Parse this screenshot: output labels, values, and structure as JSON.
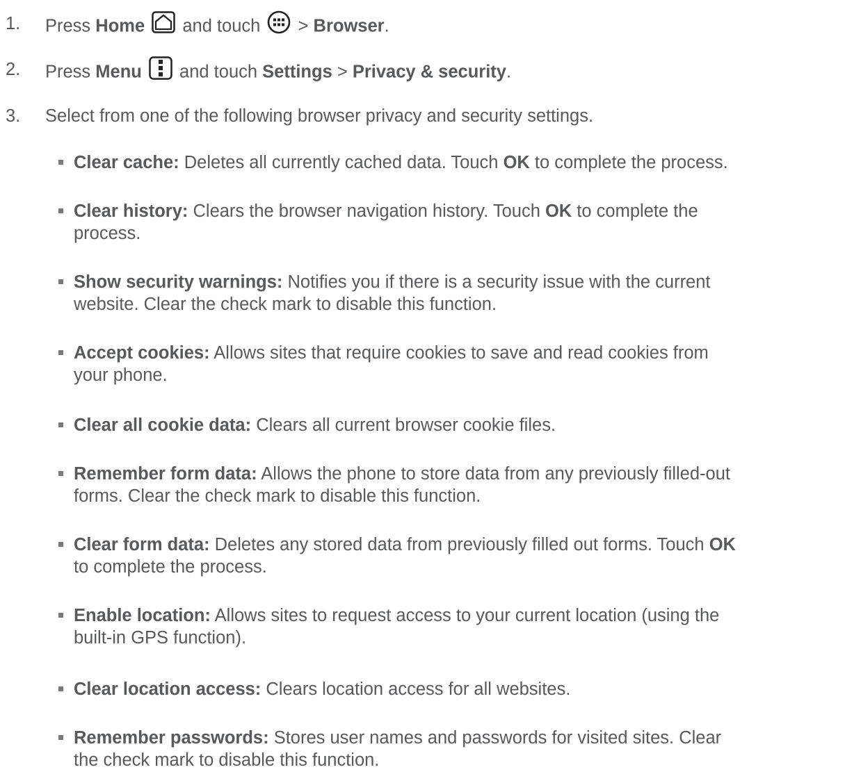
{
  "steps": [
    {
      "number": "1.",
      "parts": {
        "press": "Press",
        "home": "Home",
        "and_touch": "and touch",
        "gt": ">",
        "browser": "Browser",
        "period": "."
      }
    },
    {
      "number": "2.",
      "parts": {
        "press": "Press",
        "menu": "Menu",
        "and_touch": "and touch",
        "settings": "Settings",
        "gt": ">",
        "privacy": "Privacy & security",
        "period": "."
      }
    },
    {
      "number": "3.",
      "text": "Select from one of the following browser privacy and security settings."
    }
  ],
  "icons": [
    "home-icon",
    "apps-icon",
    "menu-icon"
  ],
  "settings": [
    {
      "label": "Clear cache:",
      "lines": [
        [
          "Deletes all currently cached data. Touch ",
          "OK",
          " to complete the process."
        ]
      ]
    },
    {
      "label": "Clear history:",
      "lines": [
        [
          "Clears the browser navigation history. Touch ",
          "OK",
          " to complete the"
        ],
        [
          "process.",
          "",
          ""
        ]
      ]
    },
    {
      "label": "Show security warnings:",
      "lines": [
        [
          "Notifies you if there is a security issue with the current",
          "",
          ""
        ],
        [
          "website. Clear the check mark to disable this function.",
          "",
          ""
        ]
      ]
    },
    {
      "label": "Accept cookies:",
      "lines": [
        [
          "Allows sites that require cookies to save and read cookies from",
          "",
          ""
        ],
        [
          "your phone.",
          "",
          ""
        ]
      ]
    },
    {
      "label": "Clear all cookie data:",
      "lines": [
        [
          "Clears all current browser cookie files.",
          "",
          ""
        ]
      ]
    },
    {
      "label": "Remember form data:",
      "lines": [
        [
          "Allows the phone to store data from any previously filled-out",
          "",
          ""
        ],
        [
          "forms. Clear the check mark to disable this function.",
          "",
          ""
        ]
      ]
    },
    {
      "label": "Clear form data:",
      "lines": [
        [
          "Deletes any stored data from previously filled out forms. Touch ",
          "OK",
          ""
        ],
        [
          "to complete the process.",
          "",
          ""
        ]
      ]
    },
    {
      "label": "Enable location:",
      "lines": [
        [
          "Allows sites to request access to your current location (using the",
          "",
          ""
        ],
        [
          "built-in GPS function).",
          "",
          ""
        ]
      ]
    },
    {
      "label": "Clear location access:",
      "lines": [
        [
          "Clears location access for all websites.",
          "",
          ""
        ]
      ]
    },
    {
      "label": "Remember passwords:",
      "lines": [
        [
          "Stores user names and passwords for visited sites. Clear",
          "",
          ""
        ],
        [
          "the check mark to disable this function.",
          "",
          ""
        ]
      ]
    }
  ]
}
